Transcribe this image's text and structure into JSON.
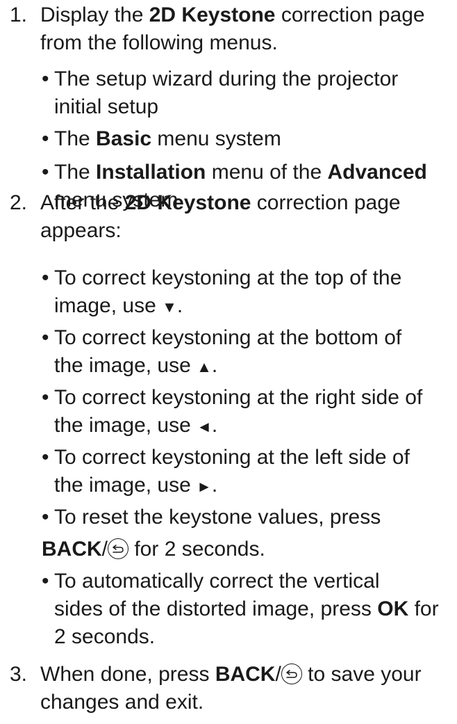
{
  "steps": [
    {
      "num": "1.",
      "line1_a": "Display the ",
      "line1_b": "2D Keystone",
      "line1_c": " correction page",
      "line2": "from the following menus.",
      "bullets": {
        "b1_l1": "The setup wizard during the projector",
        "b1_l2": "initial setup",
        "b2_a": "The ",
        "b2_b": "Basic",
        "b2_c": " menu system",
        "b3_a": "The ",
        "b3_b": "Installation",
        "b3_c": " menu of the ",
        "b3_d": "Advanced",
        "b3_l2": "menu system"
      }
    },
    {
      "num": "2.",
      "line1_a": "After the ",
      "line1_b": "2D Keystone",
      "line1_c": " correction page",
      "line2": "appears:",
      "bullets": {
        "b1_l1": "To correct keystoning at the top of the",
        "b1_l2": "image, use ",
        "b1_arrow": "▼",
        "b2_l1": "To correct keystoning at the bottom of",
        "b2_l2": "the image, use ",
        "b2_arrow": "▲",
        "b3_l1": "To correct keystoning at the right side of",
        "b3_l2": "the image, use ",
        "b3_arrow": "◄",
        "b4_l1": "To correct keystoning at the left side of",
        "b4_l2": "the image, use ",
        "b4_arrow": "►",
        "b5_l1": "To reset the keystone values, press",
        "b5_back": "BACK",
        "b5_tail": " for 2 seconds.",
        "b6_l1": "To automatically correct the vertical",
        "b6_l2_a": "sides of the distorted image, press ",
        "b6_l2_b": "OK",
        "b6_l2_c": " for",
        "b6_l3": "2 seconds."
      }
    },
    {
      "num": "3.",
      "line1_a": "When done, press ",
      "line1_b": "BACK",
      "line1_c": " to save your",
      "line2": "changes and exit."
    }
  ],
  "bullet_char": "•",
  "period": ".",
  "slash": "/",
  "icons": {
    "back": "back-arrow-circle-icon"
  }
}
